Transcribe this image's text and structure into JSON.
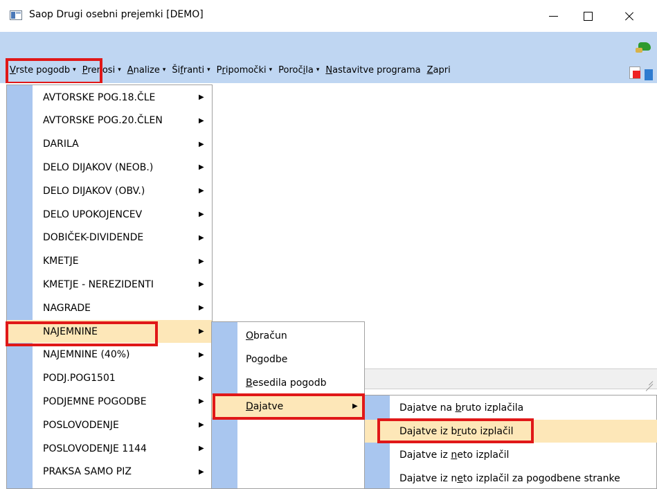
{
  "window": {
    "title": "Saop Drugi osebni prejemki [DEMO]",
    "controls": {
      "minimize": "—",
      "maximize": "☐",
      "close": "✕"
    }
  },
  "menubar": [
    {
      "pre": "",
      "u": "V",
      "post": "rste pogodb",
      "caret": "▾"
    },
    {
      "pre": "",
      "u": "P",
      "post": "renosi",
      "caret": "▾"
    },
    {
      "pre": "",
      "u": "A",
      "post": "nalize",
      "caret": "▾"
    },
    {
      "pre": "Ši",
      "u": "f",
      "post": "ranti",
      "caret": "▾"
    },
    {
      "pre": "P",
      "u": "r",
      "post": "ipomočki",
      "caret": "▾"
    },
    {
      "pre": "Poroč",
      "u": "i",
      "post": "la",
      "caret": "▾"
    },
    {
      "pre": "",
      "u": "N",
      "post": "astavitve programa",
      "caret": ""
    },
    {
      "pre": "",
      "u": "Z",
      "post": "apri",
      "caret": ""
    }
  ],
  "contract_types_menu": [
    "AVTORSKE POG.18.ČLE",
    "AVTORSKE POG.20.ČLEN",
    "DARILA",
    "DELO DIJAKOV (NEOB.)",
    "DELO DIJAKOV (OBV.)",
    "DELO UPOKOJENCEV",
    "DOBIČEK-DIVIDENDE",
    "KMETJE",
    "KMETJE - NEREZIDENTI",
    "NAGRADE",
    "NAJEMNINE",
    "NAJEMNINE (40%)",
    "PODJ.POG1501",
    "PODJEMNE POGODBE",
    "POSLOVODENJE",
    "POSLOVODENJE 1144",
    "PRAKSA SAMO PIZ"
  ],
  "selected_contract_type": "NAJEMNINE",
  "submenu_arrow": "▶",
  "najemnine_submenu": [
    {
      "pre": "",
      "u": "O",
      "post": "bračun"
    },
    {
      "pre": "Po",
      "u": "g",
      "post": "odbe"
    },
    {
      "pre": "",
      "u": "B",
      "post": "esedila pogodb"
    },
    {
      "pre": "",
      "u": "D",
      "post": "ajatve"
    }
  ],
  "selected_submenu": "Dajatve",
  "dajatve_submenu": [
    {
      "pre": "Dajatve na ",
      "u": "b",
      "post": "ruto izplačila"
    },
    {
      "pre": "Dajatve iz b",
      "u": "r",
      "post": "uto izplačil"
    },
    {
      "pre": "Dajatve iz ",
      "u": "n",
      "post": "eto izplačil"
    },
    {
      "pre": "Dajatve iz n",
      "u": "e",
      "post": "to izplačil za pogodbene stranke"
    }
  ],
  "selected_dajatve": "Dajatve iz bruto izplačil",
  "colors": {
    "toolbar_bg": "#bfd6f2",
    "menu_gutter": "#a9c6ef",
    "selection": "#fde7b8",
    "highlight_box": "#e01818"
  }
}
